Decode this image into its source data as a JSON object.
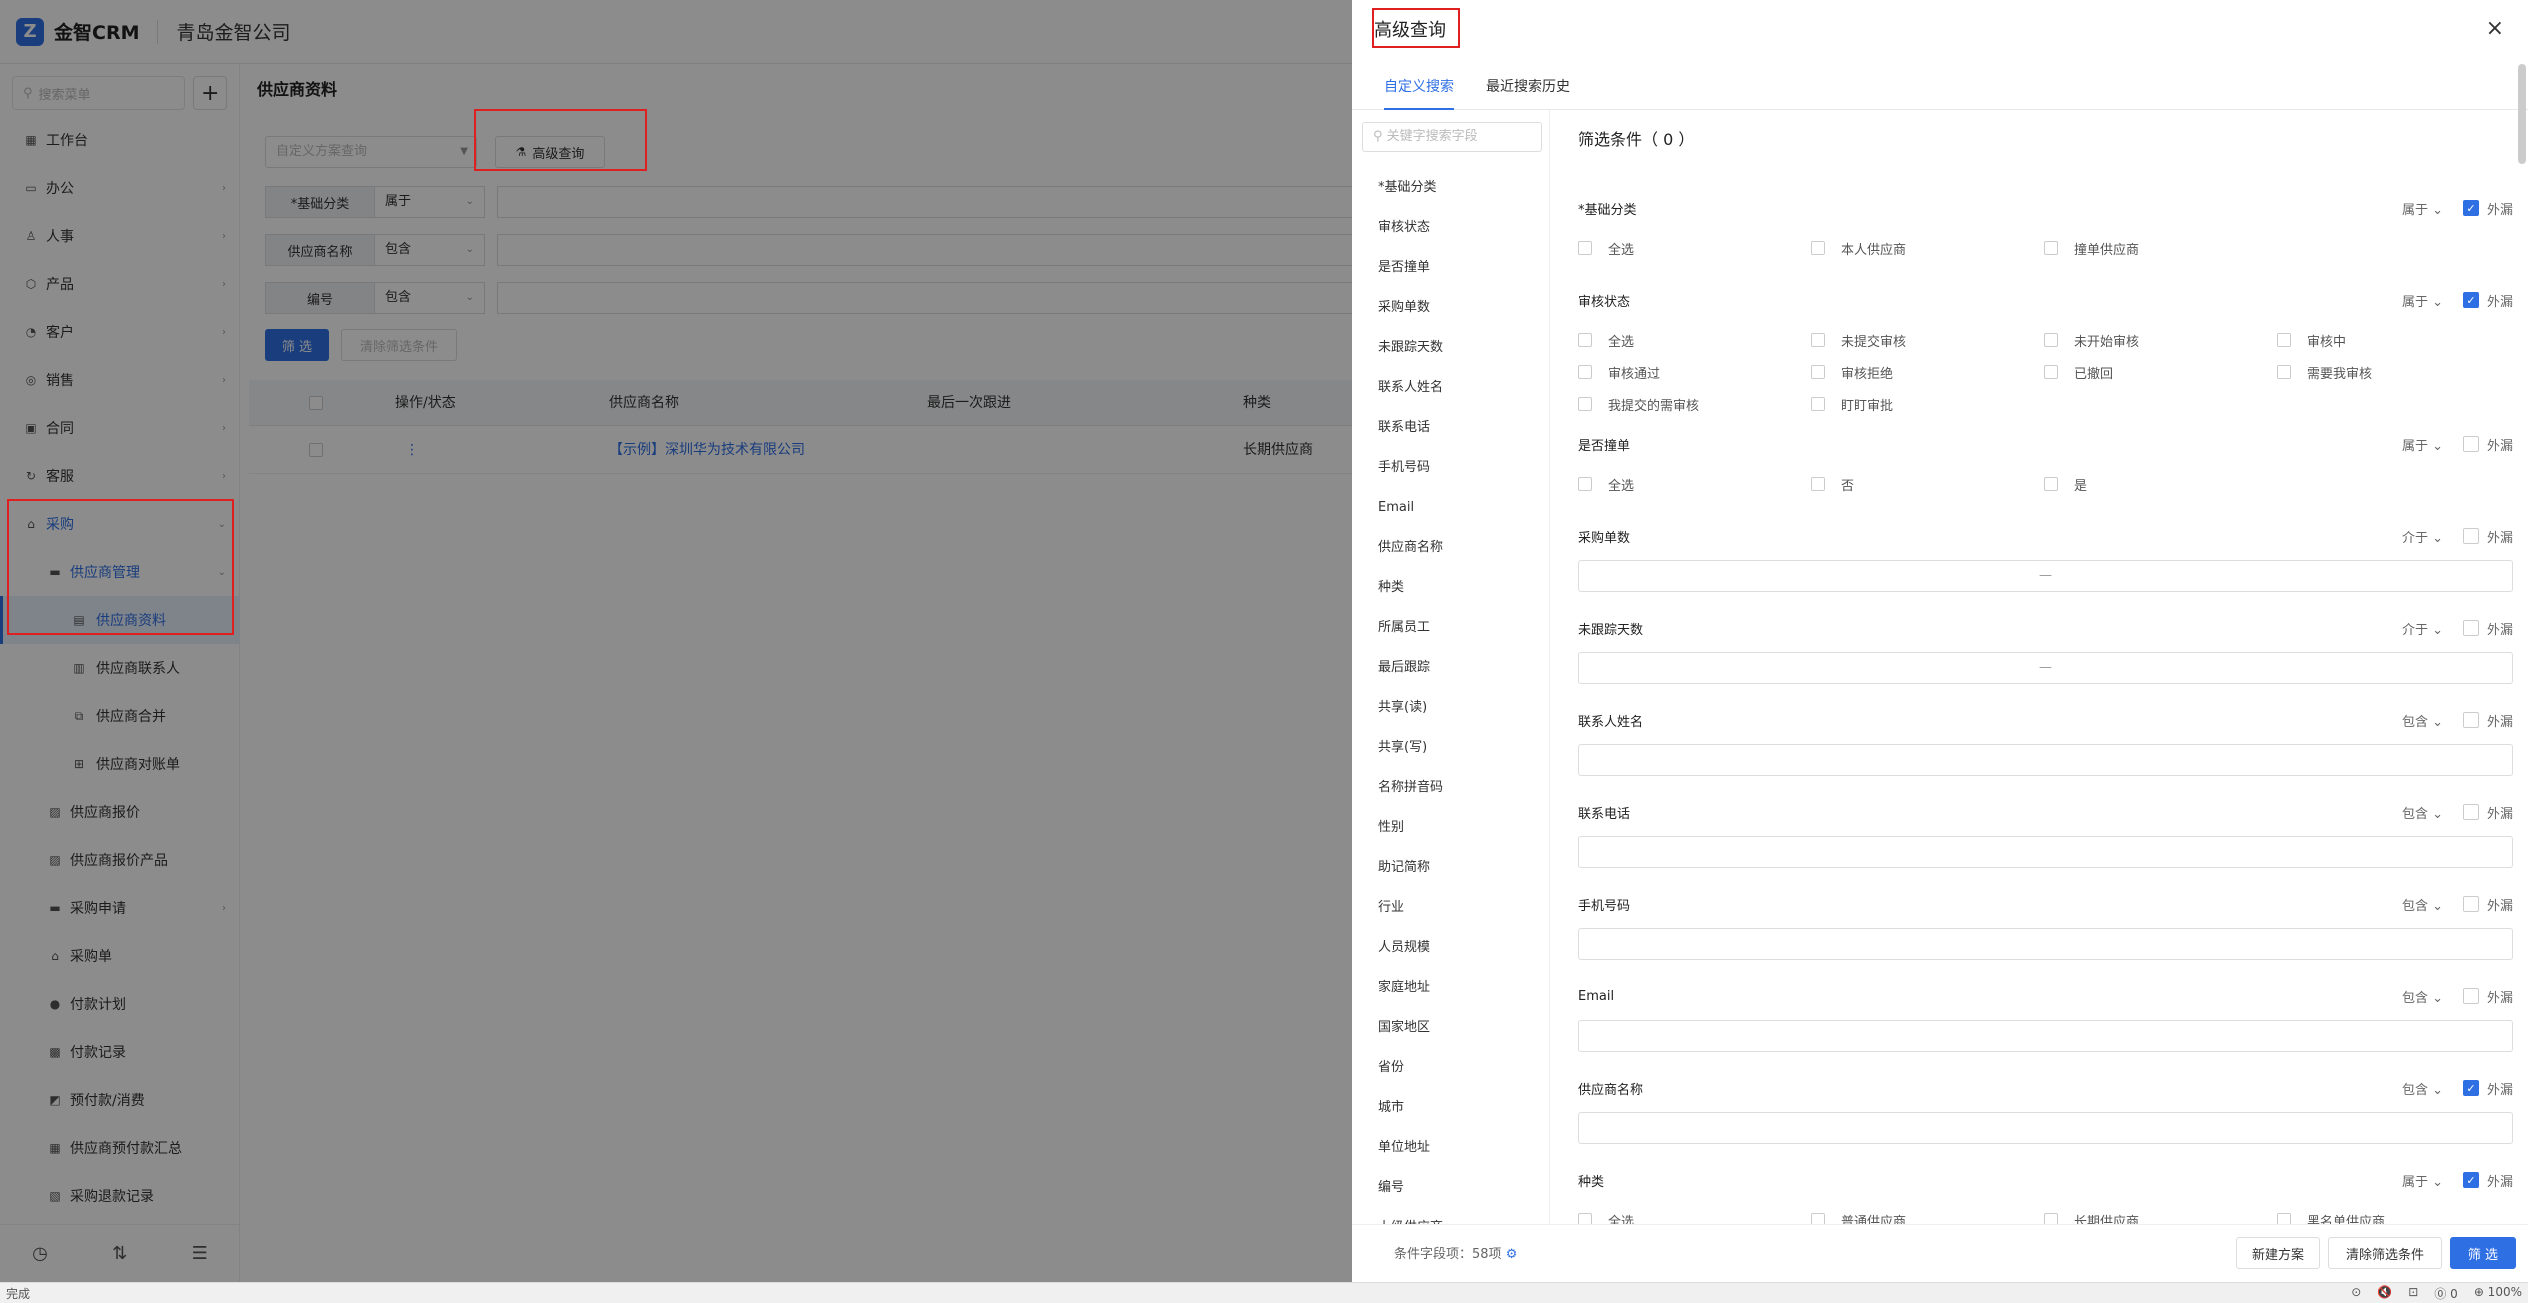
{
  "app": {
    "logo_letter": "Z",
    "name": "金智CRM",
    "company": "青岛金智公司"
  },
  "sidebar": {
    "search_placeholder": "搜索菜单",
    "plus": "+",
    "items": [
      {
        "icon": "▦",
        "label": "工作台",
        "arrow": ""
      },
      {
        "icon": "▭",
        "label": "办公",
        "arrow": "›"
      },
      {
        "icon": "♙",
        "label": "人事",
        "arrow": "›"
      },
      {
        "icon": "⬡",
        "label": "产品",
        "arrow": "›"
      },
      {
        "icon": "◔",
        "label": "客户",
        "arrow": "›"
      },
      {
        "icon": "◎",
        "label": "销售",
        "arrow": "›"
      },
      {
        "icon": "▣",
        "label": "合同",
        "arrow": "›"
      },
      {
        "icon": "↻",
        "label": "客服",
        "arrow": "›"
      },
      {
        "icon": "⌂",
        "label": "采购",
        "arrow": "⌄"
      },
      {
        "icon": "▬",
        "label": "供应商管理",
        "arrow": "⌄"
      },
      {
        "icon": "▤",
        "label": "供应商资料",
        "arrow": ""
      },
      {
        "icon": "▥",
        "label": "供应商联系人",
        "arrow": ""
      },
      {
        "icon": "⧉",
        "label": "供应商合并",
        "arrow": ""
      },
      {
        "icon": "⊞",
        "label": "供应商对账单",
        "arrow": ""
      },
      {
        "icon": "▨",
        "label": "供应商报价",
        "arrow": ""
      },
      {
        "icon": "▨",
        "label": "供应商报价产品",
        "arrow": ""
      },
      {
        "icon": "▬",
        "label": "采购申请",
        "arrow": "›"
      },
      {
        "icon": "⌂",
        "label": "采购单",
        "arrow": ""
      },
      {
        "icon": "●",
        "label": "付款计划",
        "arrow": ""
      },
      {
        "icon": "▩",
        "label": "付款记录",
        "arrow": ""
      },
      {
        "icon": "◩",
        "label": "预付款/消费",
        "arrow": ""
      },
      {
        "icon": "▦",
        "label": "供应商预付款汇总",
        "arrow": ""
      },
      {
        "icon": "▧",
        "label": "采购退款记录",
        "arrow": ""
      }
    ],
    "bottom_icons": [
      "◷",
      "⇅",
      "☰"
    ]
  },
  "content": {
    "title": "供应商资料",
    "scheme_placeholder": "自定义方案查询",
    "advanced_button": "高级查询",
    "filters": [
      {
        "label": "*基础分类",
        "op": "属于"
      },
      {
        "label": "供应商名称",
        "op": "包含"
      },
      {
        "label": "编号",
        "op": "包含"
      }
    ],
    "filter_button": "筛 选",
    "clear_button": "清除筛选条件",
    "columns": [
      "操作/状态",
      "供应商名称",
      "最后一次跟进",
      "种类"
    ],
    "rows": [
      {
        "ops": "⋮",
        "name": "【示例】深圳华为技术有限公司",
        "last": "",
        "kind": "长期供应商"
      }
    ]
  },
  "drawer": {
    "title": "高级查询",
    "close": "×",
    "tabs": [
      "自定义搜索",
      "最近搜索历史"
    ],
    "field_search_placeholder": "关键字搜索字段",
    "fields": [
      "*基础分类",
      "审核状态",
      "是否撞单",
      "采购单数",
      "未跟踪天数",
      "联系人姓名",
      "联系电话",
      "手机号码",
      "Email",
      "供应商名称",
      "种类",
      "所属员工",
      "最后跟踪",
      "共享(读)",
      "共享(写)",
      "名称拼音码",
      "性别",
      "助记简称",
      "行业",
      "人员规模",
      "家庭地址",
      "国家地区",
      "省份",
      "城市",
      "单位地址",
      "编号",
      "上级供应商"
    ],
    "conditions_title": "筛选条件（ 0 ）",
    "external_label": "外漏",
    "sections": [
      {
        "title": "*基础分类",
        "op": "属于",
        "external": true,
        "type": "options",
        "options": [
          "全选",
          "本人供应商",
          "撞单供应商"
        ]
      },
      {
        "title": "审核状态",
        "op": "属于",
        "external": true,
        "type": "options",
        "options": [
          "全选",
          "未提交审核",
          "未开始审核",
          "审核中",
          "审核通过",
          "审核拒绝",
          "已撤回",
          "需要我审核",
          "我提交的需审核",
          "盯盯审批"
        ]
      },
      {
        "title": "是否撞单",
        "op": "属于",
        "external": false,
        "type": "options",
        "options": [
          "全选",
          "否",
          "是"
        ]
      },
      {
        "title": "采购单数",
        "op": "介于",
        "external": false,
        "type": "range",
        "placeholder": "—"
      },
      {
        "title": "未跟踪天数",
        "op": "介于",
        "external": false,
        "type": "range",
        "placeholder": "—"
      },
      {
        "title": "联系人姓名",
        "op": "包含",
        "external": false,
        "type": "text",
        "placeholder": ""
      },
      {
        "title": "联系电话",
        "op": "包含",
        "external": false,
        "type": "text",
        "placeholder": ""
      },
      {
        "title": "手机号码",
        "op": "包含",
        "external": false,
        "type": "text",
        "placeholder": ""
      },
      {
        "title": "Email",
        "op": "包含",
        "external": false,
        "type": "text",
        "placeholder": ""
      },
      {
        "title": "供应商名称",
        "op": "包含",
        "external": true,
        "type": "text",
        "placeholder": ""
      },
      {
        "title": "种类",
        "op": "属于",
        "external": true,
        "type": "options",
        "options": [
          "全选",
          "普通供应商",
          "长期供应商",
          "黑名单供应商"
        ]
      }
    ],
    "footer": {
      "count_label": "条件字段项：58项",
      "new_scheme": "新建方案",
      "clear": "清除筛选条件",
      "filter": "筛 选"
    }
  },
  "status_bar": {
    "left": "完成",
    "right": [
      "⊙",
      "🔇",
      "⊡",
      "⓪ 0",
      "⊕ 100%"
    ]
  },
  "colors": {
    "accent": "#2f6fe4",
    "highlight": "#e02020"
  }
}
